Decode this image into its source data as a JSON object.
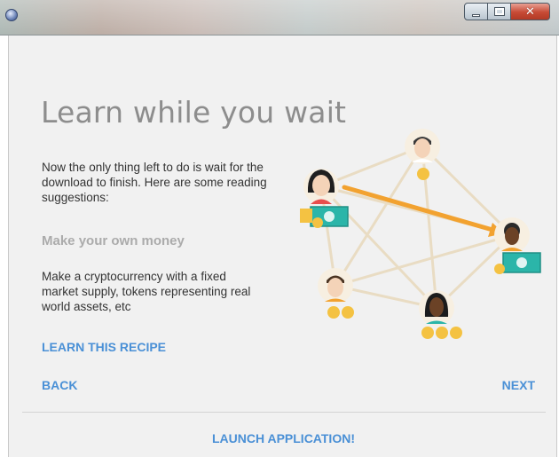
{
  "window": {
    "title": "",
    "controls": [
      "minimize",
      "maximize",
      "close"
    ]
  },
  "main": {
    "headline": "Learn while you wait",
    "intro": "Now the only thing left to do is wait for the download to finish. Here are some reading suggestions:",
    "suggestion": {
      "title": "Make your own money",
      "description": "Make a cryptocurrency with a fixed market supply, tokens representing real world assets, etc",
      "link_label": "LEARN THIS RECIPE"
    },
    "nav": {
      "back_label": "BACK",
      "next_label": "NEXT"
    },
    "launch_label": "LAUNCH APPLICATION!"
  },
  "illustration": {
    "description_icons": [
      "person-avatar",
      "coin-icon",
      "banknote-icon",
      "arrow"
    ],
    "colors": {
      "link": "#4a90d6",
      "line": "#e8d9bd",
      "arrow": "#f2a230",
      "coin": "#f4c242",
      "banknote": "#2bb5a9"
    }
  }
}
